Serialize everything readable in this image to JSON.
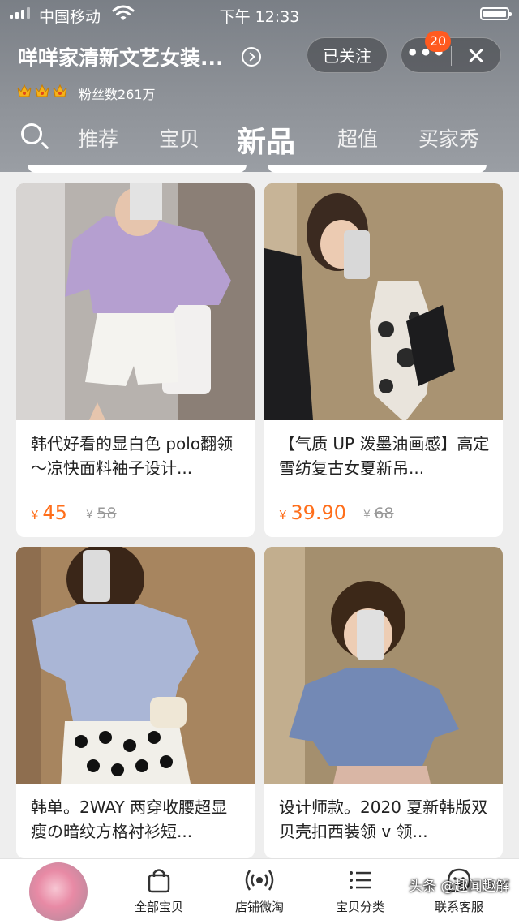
{
  "status_bar": {
    "carrier": "中国移动",
    "time": "下午 12:33"
  },
  "shop": {
    "name": "咩咩家清新文艺女装...",
    "follow_label": "已关注",
    "more_label": "•••",
    "badge_count": "20",
    "fans_text": "粉丝数261万"
  },
  "tabs": [
    {
      "label": "推荐"
    },
    {
      "label": "宝贝"
    },
    {
      "label": "新品",
      "active": true
    },
    {
      "label": "超值"
    },
    {
      "label": "买家秀"
    }
  ],
  "products": [
    {
      "title": "韩代好看的显白色 polo翻领～凉快面料袖子设计...",
      "price_symbol": "¥",
      "price": "45",
      "orig_symbol": "¥",
      "orig_price": "58"
    },
    {
      "title": "【气质 UP 泼墨油画感】高定雪纺复古女夏新吊...",
      "price_symbol": "¥",
      "price": "39.90",
      "orig_symbol": "¥",
      "orig_price": "68"
    },
    {
      "title": "韩单。2WAY 两穿收腰超显瘦の暗纹方格衬衫短...",
      "price_symbol": "",
      "price": "",
      "orig_symbol": "",
      "orig_price": ""
    },
    {
      "title": "设计师款。2020 夏新韩版双贝壳扣西装领 v 领...",
      "price_symbol": "",
      "price": "",
      "orig_symbol": "",
      "orig_price": ""
    }
  ],
  "bottom_nav": [
    {
      "label": "全部宝贝",
      "icon": "shopping-bag-icon"
    },
    {
      "label": "店铺微淘",
      "icon": "broadcast-icon"
    },
    {
      "label": "宝贝分类",
      "icon": "list-icon"
    },
    {
      "label": "联系客服",
      "icon": "chat-face-icon"
    }
  ],
  "watermark": "头条 @趣闻趣解",
  "colors": {
    "accent_price": "#ff6e1a",
    "badge": "#ff5a1f",
    "header": "#8d9197"
  }
}
